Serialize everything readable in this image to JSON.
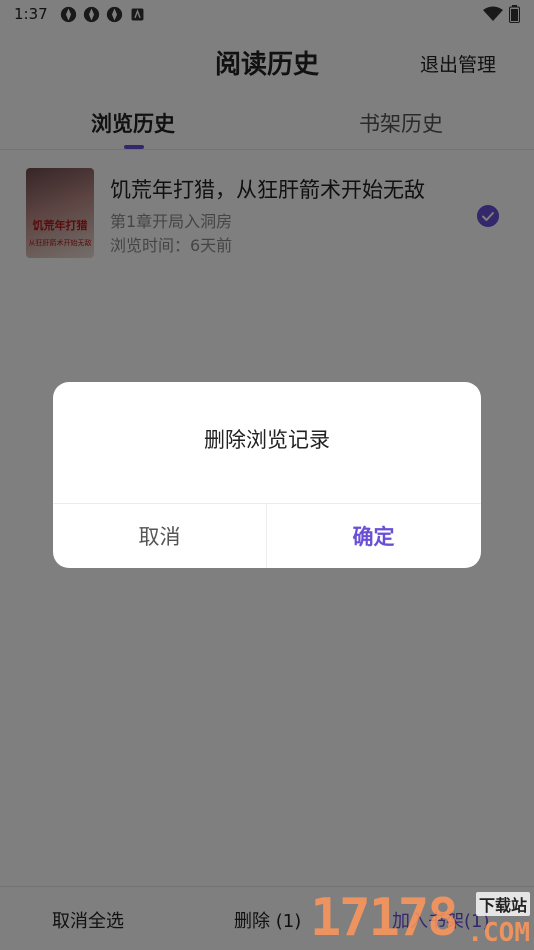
{
  "status_bar": {
    "time": "1:37",
    "left_icons": [
      "aperture-icon",
      "aperture-icon",
      "aperture-icon",
      "app-notification-icon"
    ],
    "right_icons": [
      "wifi-icon",
      "battery-icon"
    ]
  },
  "header": {
    "title": "阅读历史",
    "exit_manage": "退出管理"
  },
  "tabs": [
    {
      "label": "浏览历史",
      "active": true
    },
    {
      "label": "书架历史",
      "active": false
    }
  ],
  "list": {
    "items": [
      {
        "title": "饥荒年打猎，从狂肝箭术开始无敌",
        "chapter": "第1章开局入洞房",
        "browse_time": "浏览时间：6天前",
        "cover_title": "饥荒年打猎",
        "cover_subtitle": "从狂肝箭术开始无敌",
        "selected": true
      }
    ]
  },
  "dialog": {
    "title": "删除浏览记录",
    "cancel": "取消",
    "confirm": "确定"
  },
  "bottom_bar": {
    "cancel_select_all": "取消全选",
    "delete": "删除 (1)",
    "add_to_shelf": "加入书架(1)"
  },
  "watermark": {
    "number": "17178",
    "site": "下载站",
    "domain": ".COM"
  },
  "colors": {
    "accent": "#6a4fd6",
    "overlay": "rgba(0,0,0,0.5)",
    "secondary_text": "#8a8a8a"
  }
}
